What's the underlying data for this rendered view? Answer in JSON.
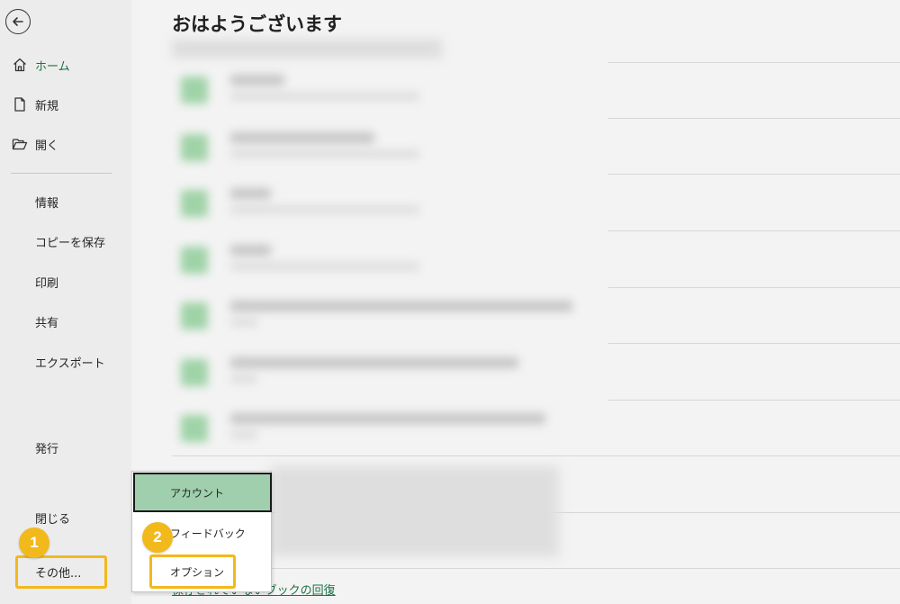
{
  "sidebar": {
    "back_icon": "arrow-left-circle-icon",
    "items": [
      {
        "label": "ホーム",
        "icon": "home-icon"
      },
      {
        "label": "新規",
        "icon": "new-document-icon"
      },
      {
        "label": "開く",
        "icon": "open-folder-icon"
      },
      {
        "label": "情報"
      },
      {
        "label": "コピーを保存"
      },
      {
        "label": "印刷"
      },
      {
        "label": "共有"
      },
      {
        "label": "エクスポート"
      },
      {
        "label": "発行"
      },
      {
        "label": "閉じる"
      },
      {
        "label": "その他..."
      }
    ]
  },
  "main": {
    "greeting": "おはようございます",
    "recover_link": "保存されていないブックの回復"
  },
  "popup_menu": {
    "items": [
      {
        "label": "アカウント"
      },
      {
        "label": "フィードバック"
      },
      {
        "label": "オプション"
      }
    ]
  },
  "annotations": {
    "step1": "1",
    "step2": "2"
  },
  "colors": {
    "accent_green": "#1e7145",
    "menu_highlight": "#9fcfad",
    "callout_yellow": "#f2b91d"
  }
}
